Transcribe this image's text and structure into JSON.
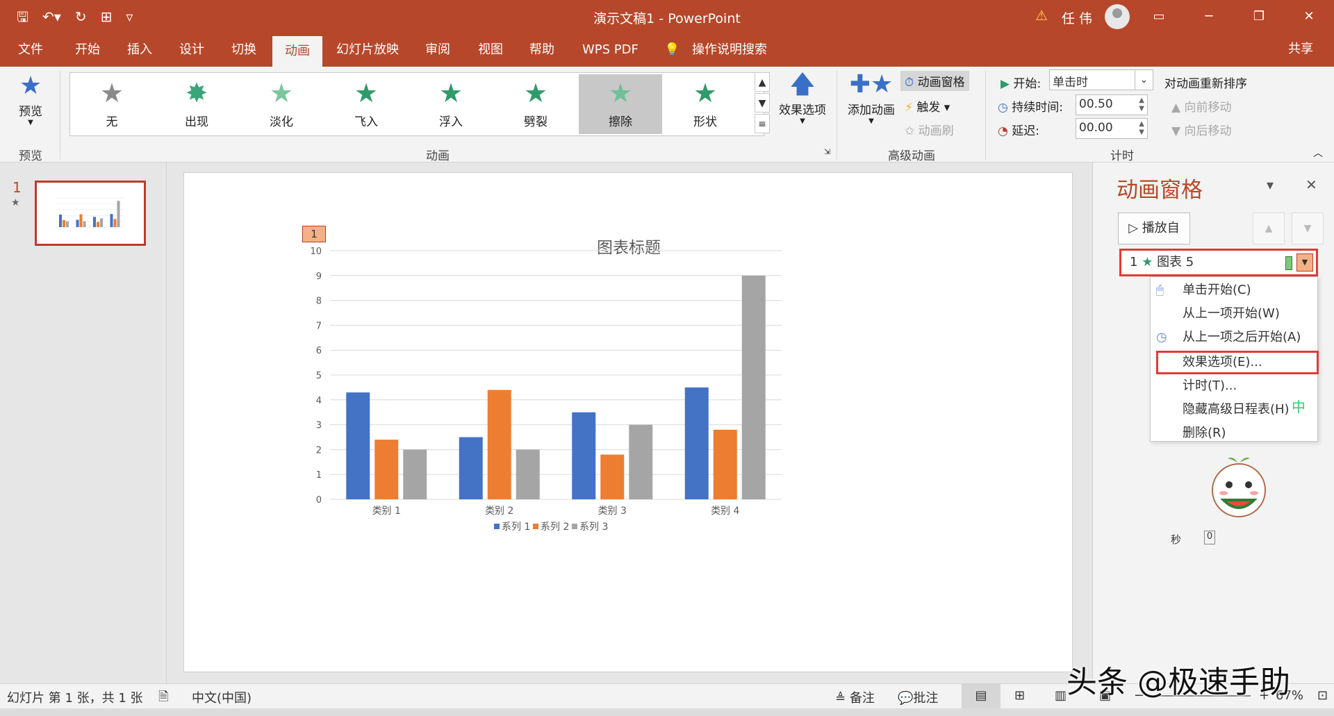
{
  "titlebar": {
    "title": "演示文稿1  -  PowerPoint",
    "username": "任 伟",
    "qat_icons": [
      "save-icon",
      "undo-icon",
      "redo-icon",
      "present-icon",
      "customize-icon"
    ]
  },
  "tabs": [
    "文件",
    "开始",
    "插入",
    "设计",
    "切换",
    "动画",
    "幻灯片放映",
    "审阅",
    "视图",
    "帮助",
    "WPS PDF",
    "操作说明搜索"
  ],
  "active_tab": "动画",
  "share_label": "共享",
  "ribbon": {
    "preview_label": "预览",
    "preview_group": "预览",
    "animations_group": "动画",
    "gallery": [
      "无",
      "出现",
      "淡化",
      "飞入",
      "浮入",
      "劈裂",
      "擦除",
      "形状"
    ],
    "selected_animation": "擦除",
    "effect_options": "效果选项",
    "add_animation": "添加动画",
    "anim_pane_btn": "动画窗格",
    "trigger": "触发",
    "anim_painter": "动画刷",
    "advanced_group": "高级动画",
    "start_label": "开始:",
    "start_value": "单击时",
    "duration_label": "持续时间:",
    "duration_value": "00.50",
    "delay_label": "延迟:",
    "delay_value": "00.00",
    "reorder_label": "对动画重新排序",
    "move_earlier": "向前移动",
    "move_later": "向后移动",
    "timing_group": "计时"
  },
  "slides_panel": {
    "number": "1"
  },
  "slide": {
    "anim_tag": "1"
  },
  "chart_data": {
    "type": "bar",
    "title": "图表标题",
    "categories": [
      "类别 1",
      "类别 2",
      "类别 3",
      "类别 4"
    ],
    "series": [
      {
        "name": "系列 1",
        "values": [
          4.3,
          2.5,
          3.5,
          4.5
        ],
        "color": "#4472c4"
      },
      {
        "name": "系列 2",
        "values": [
          2.4,
          4.4,
          1.8,
          2.8
        ],
        "color": "#ed7d31"
      },
      {
        "name": "系列 3",
        "values": [
          2,
          2,
          3,
          9
        ],
        "color": "#a5a5a5"
      }
    ],
    "ylim": [
      0,
      10
    ],
    "yticks": [
      "0",
      "1",
      "2",
      "3",
      "4",
      "5",
      "6",
      "7",
      "8",
      "9",
      "10"
    ],
    "grid": true,
    "legend": "bottom"
  },
  "pane": {
    "title": "动画窗格",
    "play_from": "播放自",
    "item_number": "1",
    "item_label": "图表 5",
    "menu": [
      "单击开始(C)",
      "从上一项开始(W)",
      "从上一项之后开始(A)",
      "效果选项(E)...",
      "计时(T)...",
      "隐藏高级日程表(H)",
      "删除(R)"
    ],
    "seconds_label": "秒",
    "seconds_value": "0"
  },
  "status": {
    "slide_info": "幻灯片 第 1 张，共 1 张",
    "language": "中文(中国)",
    "notes": "备注",
    "comments": "批注",
    "zoom": "67%"
  },
  "watermark": "头条 @极速手助"
}
